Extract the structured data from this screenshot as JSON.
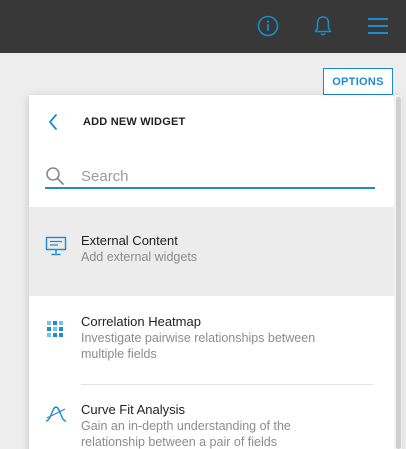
{
  "topbar": {
    "info_icon": "info-circle-icon",
    "bell_icon": "bell-icon",
    "menu_icon": "hamburger-menu-icon"
  },
  "options_button": {
    "label": "OPTIONS"
  },
  "panel": {
    "title": "ADD NEW WIDGET",
    "back_icon": "chevron-left-icon",
    "search": {
      "placeholder": "Search",
      "value": ""
    },
    "items": [
      {
        "title": "External Content",
        "description": "Add external widgets",
        "icon": "monitor-icon",
        "selected": true
      },
      {
        "title": "Correlation Heatmap",
        "description": "Investigate pairwise relationships between multiple fields",
        "icon": "heatmap-grid-icon",
        "selected": false
      },
      {
        "title": "Curve Fit Analysis",
        "description": "Gain an in-depth understanding of the relationship between a pair of fields",
        "icon": "curve-icon",
        "selected": false
      }
    ]
  },
  "colors": {
    "accent": "#1a8ccf",
    "topbar": "#383838",
    "background": "#ededed",
    "selected_row": "#ececec"
  }
}
